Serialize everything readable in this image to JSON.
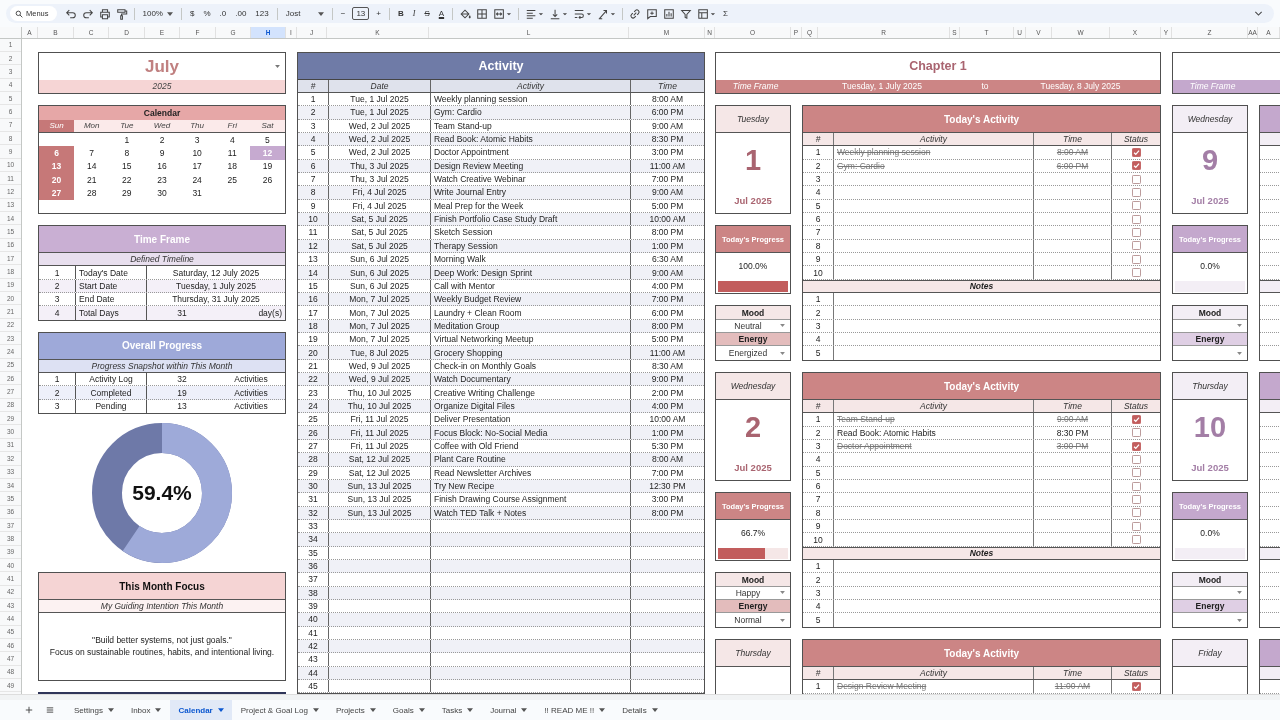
{
  "toolbar": {
    "menus_label": "Menus",
    "groups": [
      [
        {
          "kind": "undo"
        },
        {
          "kind": "redo"
        },
        {
          "kind": "print"
        },
        {
          "kind": "paint"
        }
      ],
      [
        {
          "kind": "menu",
          "label": "100%"
        }
      ],
      [
        {
          "kind": "text",
          "label": "$"
        },
        {
          "kind": "text",
          "label": "%"
        },
        {
          "kind": "text",
          "label": ".0"
        },
        {
          "kind": "text",
          "label": ".00"
        },
        {
          "kind": "text",
          "label": "123"
        }
      ],
      [
        {
          "kind": "font",
          "label": "Jost"
        }
      ],
      [
        {
          "kind": "text",
          "label": "−"
        },
        {
          "kind": "size",
          "label": "13"
        },
        {
          "kind": "text",
          "label": "+"
        }
      ],
      [
        {
          "kind": "bold",
          "label": "B"
        },
        {
          "kind": "italic",
          "label": "I"
        },
        {
          "kind": "strike",
          "label": "S"
        },
        {
          "kind": "color",
          "label": "A"
        }
      ],
      [
        {
          "kind": "fill"
        },
        {
          "kind": "borders"
        },
        {
          "kind": "merge"
        }
      ],
      [
        {
          "kind": "align"
        },
        {
          "kind": "valign"
        },
        {
          "kind": "wrap"
        },
        {
          "kind": "rotate"
        }
      ],
      [
        {
          "kind": "link"
        },
        {
          "kind": "comment"
        },
        {
          "kind": "chart"
        },
        {
          "kind": "filter"
        },
        {
          "kind": "views"
        },
        {
          "kind": "text",
          "label": "Σ"
        }
      ]
    ]
  },
  "column_headers": [
    {
      "label": "A",
      "selected": false
    },
    {
      "label": "B",
      "selected": false
    },
    {
      "label": "C",
      "selected": false
    },
    {
      "label": "D",
      "selected": false
    },
    {
      "label": "E",
      "selected": false
    },
    {
      "label": "F",
      "selected": false
    },
    {
      "label": "G",
      "selected": false
    },
    {
      "label": "H",
      "selected": true
    },
    {
      "label": "I",
      "selected": false
    },
    {
      "label": "J",
      "selected": false
    },
    {
      "label": "K",
      "selected": false
    },
    {
      "label": "L",
      "selected": false
    },
    {
      "label": "M",
      "selected": false
    },
    {
      "label": "N",
      "selected": false
    },
    {
      "label": "O",
      "selected": false
    },
    {
      "label": "P",
      "selected": false
    },
    {
      "label": "Q",
      "selected": false
    },
    {
      "label": "R",
      "selected": false
    },
    {
      "label": "S",
      "selected": false
    },
    {
      "label": "T",
      "selected": false
    },
    {
      "label": "U",
      "selected": false
    },
    {
      "label": "V",
      "selected": false
    },
    {
      "label": "W",
      "selected": false
    },
    {
      "label": "X",
      "selected": false
    },
    {
      "label": "Y",
      "selected": false
    },
    {
      "label": "Z",
      "selected": false
    },
    {
      "label": "AA",
      "selected": false
    },
    {
      "label": "A",
      "selected": false
    }
  ],
  "row_numbers": [
    "1",
    "2",
    "3",
    "4",
    "5",
    "6",
    "7",
    "8",
    "9",
    "10",
    "11",
    "12",
    "13",
    "14",
    "15",
    "16",
    "17",
    "18",
    "19",
    "20",
    "21",
    "22",
    "23",
    "24",
    "25",
    "26",
    "27",
    "28",
    "29",
    "30",
    "31",
    "32",
    "33",
    "34",
    "35",
    "36",
    "37",
    "38",
    "39",
    "40",
    "41",
    "42",
    "43",
    "44",
    "45",
    "46",
    "47",
    "48",
    "49"
  ],
  "month_card": {
    "month": "July",
    "year": "2025"
  },
  "calendar": {
    "title": "Calendar",
    "weekdays": [
      "Sun",
      "Mon",
      "Tue",
      "Wed",
      "Thu",
      "Fri",
      "Sat"
    ],
    "weeks": [
      [
        {
          "label": "1",
          "selected": false
        },
        {
          "label": "2",
          "selected": false
        },
        {
          "label": "3",
          "selected": false
        },
        {
          "label": "4",
          "selected": false
        },
        {
          "label": "5",
          "selected": false
        }
      ],
      [
        {
          "label": "6",
          "selected": false
        },
        {
          "label": "7",
          "selected": false
        },
        {
          "label": "8",
          "selected": false
        },
        {
          "label": "9",
          "selected": false
        },
        {
          "label": "10",
          "selected": false
        },
        {
          "label": "11",
          "selected": false
        },
        {
          "label": "12",
          "selected": true
        }
      ],
      [
        {
          "label": "13",
          "selected": false
        },
        {
          "label": "14",
          "selected": false
        },
        {
          "label": "15",
          "selected": false
        },
        {
          "label": "16",
          "selected": false
        },
        {
          "label": "17",
          "selected": false
        },
        {
          "label": "18",
          "selected": false
        },
        {
          "label": "19",
          "selected": false
        }
      ],
      [
        {
          "label": "20",
          "selected": false
        },
        {
          "label": "21",
          "selected": false
        },
        {
          "label": "22",
          "selected": false
        },
        {
          "label": "23",
          "selected": false
        },
        {
          "label": "24",
          "selected": false
        },
        {
          "label": "25",
          "selected": false
        },
        {
          "label": "26",
          "selected": false
        }
      ],
      [
        {
          "label": "27",
          "selected": false
        },
        {
          "label": "28",
          "selected": false
        },
        {
          "label": "29",
          "selected": false
        },
        {
          "label": "30",
          "selected": false
        },
        {
          "label": "31",
          "selected": false
        }
      ]
    ]
  },
  "time_frame": {
    "title": "Time Frame",
    "subtitle": "Defined Timeline",
    "rows": [
      {
        "n": "1",
        "label": "Today's Date",
        "value": "Saturday, 12 July 2025"
      },
      {
        "n": "2",
        "label": "Start Date",
        "value": "Tuesday, 1 July 2025"
      },
      {
        "n": "3",
        "label": "End Date",
        "value": "Thursday, 31 July 2025"
      },
      {
        "n": "4",
        "label": "Total Days",
        "value": "31",
        "unit": "day(s)"
      }
    ]
  },
  "overall_progress": {
    "title": "Overall Progress",
    "subtitle": "Progress Snapshot within This Month",
    "rows": [
      {
        "n": "1",
        "label": "Activity Log",
        "count": "32",
        "unit": "Activities"
      },
      {
        "n": "2",
        "label": "Completed",
        "count": "19",
        "unit": "Activities"
      },
      {
        "n": "3",
        "label": "Pending",
        "count": "13",
        "unit": "Activities"
      }
    ],
    "ring": {
      "label": "59.4%",
      "level": 0.594
    }
  },
  "focus": {
    "title": "This Month Focus",
    "subtitle": "My Guiding Intention This Month",
    "text": "\"Build better systems, not just goals.\"\nFocus on sustainable routines, habits, and intentional living."
  },
  "activity": {
    "title": "Activity",
    "columns": [
      "#",
      "Date",
      "Activity",
      "Time"
    ],
    "rows": [
      {
        "n": "1",
        "date": "Tue, 1 Jul 2025",
        "activity": "Weekly planning session",
        "time": "8:00 AM"
      },
      {
        "n": "2",
        "date": "Tue, 1 Jul 2025",
        "activity": "Gym: Cardio",
        "time": "6:00 PM"
      },
      {
        "n": "3",
        "date": "Wed, 2 Jul 2025",
        "activity": "Team Stand-up",
        "time": "9:00 AM"
      },
      {
        "n": "4",
        "date": "Wed, 2 Jul 2025",
        "activity": "Read Book: Atomic Habits",
        "time": "8:30 PM"
      },
      {
        "n": "5",
        "date": "Wed, 2 Jul 2025",
        "activity": "Doctor Appointment",
        "time": "3:00 PM"
      },
      {
        "n": "6",
        "date": "Thu, 3 Jul 2025",
        "activity": "Design Review Meeting",
        "time": "11:00 AM"
      },
      {
        "n": "7",
        "date": "Thu, 3 Jul 2025",
        "activity": "Watch Creative Webinar",
        "time": "7:00 PM"
      },
      {
        "n": "8",
        "date": "Fri, 4 Jul 2025",
        "activity": "Write Journal Entry",
        "time": "9:00 AM"
      },
      {
        "n": "9",
        "date": "Fri, 4 Jul 2025",
        "activity": "Meal Prep for the Week",
        "time": "5:00 PM"
      },
      {
        "n": "10",
        "date": "Sat, 5 Jul 2025",
        "activity": "Finish Portfolio Case Study Draft",
        "time": "10:00 AM"
      },
      {
        "n": "11",
        "date": "Sat, 5 Jul 2025",
        "activity": "Sketch Session",
        "time": "8:00 PM"
      },
      {
        "n": "12",
        "date": "Sat, 5 Jul 2025",
        "activity": "Therapy Session",
        "time": "1:00 PM"
      },
      {
        "n": "13",
        "date": "Sun, 6 Jul 2025",
        "activity": "Morning Walk",
        "time": "6:30 AM"
      },
      {
        "n": "14",
        "date": "Sun, 6 Jul 2025",
        "activity": "Deep Work: Design Sprint",
        "time": "9:00 AM"
      },
      {
        "n": "15",
        "date": "Sun, 6 Jul 2025",
        "activity": "Call with Mentor",
        "time": "4:00 PM"
      },
      {
        "n": "16",
        "date": "Mon, 7 Jul 2025",
        "activity": "Weekly Budget Review",
        "time": "7:00 PM"
      },
      {
        "n": "17",
        "date": "Mon, 7 Jul 2025",
        "activity": "Laundry + Clean Room",
        "time": "6:00 PM"
      },
      {
        "n": "18",
        "date": "Mon, 7 Jul 2025",
        "activity": "Meditation Group",
        "time": "8:00 PM"
      },
      {
        "n": "19",
        "date": "Mon, 7 Jul 2025",
        "activity": "Virtual Networking Meetup",
        "time": "5:00 PM"
      },
      {
        "n": "20",
        "date": "Tue, 8 Jul 2025",
        "activity": "Grocery Shopping",
        "time": "11:00 AM"
      },
      {
        "n": "21",
        "date": "Wed, 9 Jul 2025",
        "activity": "Check-in on Monthly Goals",
        "time": "8:30 AM"
      },
      {
        "n": "22",
        "date": "Wed, 9 Jul 2025",
        "activity": "Watch Documentary",
        "time": "9:00 PM"
      },
      {
        "n": "23",
        "date": "Thu, 10 Jul 2025",
        "activity": "Creative Writing Challenge",
        "time": "2:00 PM"
      },
      {
        "n": "24",
        "date": "Thu, 10 Jul 2025",
        "activity": "Organize Digital Files",
        "time": "4:00 PM"
      },
      {
        "n": "25",
        "date": "Fri, 11 Jul 2025",
        "activity": "Deliver Presentation",
        "time": "10:00 AM"
      },
      {
        "n": "26",
        "date": "Fri, 11 Jul 2025",
        "activity": "Focus Block: No-Social Media",
        "time": "1:00 PM"
      },
      {
        "n": "27",
        "date": "Fri, 11 Jul 2025",
        "activity": "Coffee with Old Friend",
        "time": "5:30 PM"
      },
      {
        "n": "28",
        "date": "Sat, 12 Jul 2025",
        "activity": "Plant Care Routine",
        "time": "8:00 AM"
      },
      {
        "n": "29",
        "date": "Sat, 12 Jul 2025",
        "activity": "Read Newsletter Archives",
        "time": "7:00 PM"
      },
      {
        "n": "30",
        "date": "Sun, 13 Jul 2025",
        "activity": "Try New Recipe",
        "time": "12:30 PM"
      },
      {
        "n": "31",
        "date": "Sun, 13 Jul 2025",
        "activity": "Finish Drawing Course Assignment",
        "time": "3:00 PM"
      },
      {
        "n": "32",
        "date": "Sun, 13 Jul 2025",
        "activity": "Watch TED Talk + Notes",
        "time": "8:00 PM"
      },
      {
        "n": "33"
      },
      {
        "n": "34"
      },
      {
        "n": "35"
      },
      {
        "n": "36"
      },
      {
        "n": "37"
      },
      {
        "n": "38"
      },
      {
        "n": "39"
      },
      {
        "n": "40"
      },
      {
        "n": "41"
      },
      {
        "n": "42"
      },
      {
        "n": "43"
      },
      {
        "n": "44"
      },
      {
        "n": "45"
      }
    ]
  },
  "chapters": [
    {
      "title": "Chapter 1",
      "color": "#cc8585",
      "time_frame": {
        "label": "Time Frame",
        "start": "Tuesday, 1 July 2025",
        "to": "to",
        "end": "Tuesday, 8 July 2025"
      },
      "days": [
        {
          "weekday": "Tuesday",
          "day": "1",
          "month": "Jul 2025",
          "progress": {
            "title": "Today's Progress",
            "label": "100.0%",
            "level": 1
          },
          "mood": {
            "title": "Mood",
            "value": "Neutral"
          },
          "energy": {
            "title": "Energy",
            "value": "Energized"
          },
          "activity": {
            "title": "Today's Activity",
            "columns": [
              "#",
              "Activity",
              "Time",
              "Status"
            ],
            "rows": [
              {
                "n": "1",
                "activity": "Weekly planning session",
                "time": "8:00 AM",
                "checked": true
              },
              {
                "n": "2",
                "activity": "Gym: Cardio",
                "time": "6:00 PM",
                "checked": true
              },
              {
                "n": "3",
                "checked": false
              },
              {
                "n": "4",
                "checked": false
              },
              {
                "n": "5",
                "checked": false
              },
              {
                "n": "6",
                "checked": false
              },
              {
                "n": "7",
                "checked": false
              },
              {
                "n": "8",
                "checked": false
              },
              {
                "n": "9",
                "checked": false
              },
              {
                "n": "10",
                "checked": false
              }
            ]
          },
          "notes": {
            "title": "Notes",
            "rows": [
              "1",
              "2",
              "3",
              "4",
              "5"
            ]
          }
        },
        {
          "weekday": "Wednesday",
          "day": "2",
          "month": "Jul 2025",
          "progress": {
            "title": "Today's Progress",
            "label": "66.7%",
            "level": 0.667
          },
          "mood": {
            "title": "Mood",
            "value": "Happy"
          },
          "energy": {
            "title": "Energy",
            "value": "Normal"
          },
          "activity": {
            "title": "Today's Activity",
            "columns": [
              "#",
              "Activity",
              "Time",
              "Status"
            ],
            "rows": [
              {
                "n": "1",
                "activity": "Team Stand-up",
                "time": "9:00 AM",
                "checked": true
              },
              {
                "n": "2",
                "activity": "Read Book: Atomic Habits",
                "time": "8:30 PM",
                "checked": false
              },
              {
                "n": "3",
                "activity": "Doctor Appointment",
                "time": "3:00 PM",
                "checked": true
              },
              {
                "n": "4",
                "checked": false
              },
              {
                "n": "5",
                "checked": false
              },
              {
                "n": "6",
                "checked": false
              },
              {
                "n": "7",
                "checked": false
              },
              {
                "n": "8",
                "checked": false
              },
              {
                "n": "9",
                "checked": false
              },
              {
                "n": "10",
                "checked": false
              }
            ]
          },
          "notes": {
            "title": "Notes",
            "rows": [
              "1",
              "2",
              "3",
              "4",
              "5"
            ]
          }
        },
        {
          "weekday": "Thursday",
          "activity": {
            "title": "Today's Activity",
            "columns": [
              "#",
              "Activity",
              "Time",
              "Status"
            ],
            "rows": [
              {
                "n": "1",
                "activity": "Design Review Meeting",
                "time": "11:00 AM",
                "checked": true
              }
            ]
          }
        }
      ]
    },
    {
      "color": "#c4a8cd",
      "time_frame": {
        "label": "Time Frame"
      },
      "days": [
        {
          "weekday": "Wednesday",
          "day": "9",
          "month": "Jul 2025",
          "progress": {
            "title": "Today's Progress",
            "label": "0.0%",
            "level": 0
          },
          "mood": {
            "title": "Mood"
          },
          "energy": {
            "title": "Energy"
          }
        },
        {
          "weekday": "Thursday",
          "day": "10",
          "month": "Jul 2025",
          "progress": {
            "title": "Today's Progress",
            "label": "0.0%",
            "level": 0
          },
          "mood": {
            "title": "Mood"
          },
          "energy": {
            "title": "Energy"
          }
        },
        {
          "weekday": "Friday"
        }
      ]
    }
  ],
  "sheet_tabs": [
    {
      "label": "Settings",
      "selected": false
    },
    {
      "label": "Inbox",
      "selected": false
    },
    {
      "label": "Calendar",
      "selected": true
    },
    {
      "label": "Project & Goal Log",
      "selected": false
    },
    {
      "label": "Projects",
      "selected": false
    },
    {
      "label": "Goals",
      "selected": false
    },
    {
      "label": "Tasks",
      "selected": false
    },
    {
      "label": "Journal",
      "selected": false
    },
    {
      "label": "!! READ ME !!",
      "selected": false
    },
    {
      "label": "Details",
      "selected": false
    }
  ]
}
